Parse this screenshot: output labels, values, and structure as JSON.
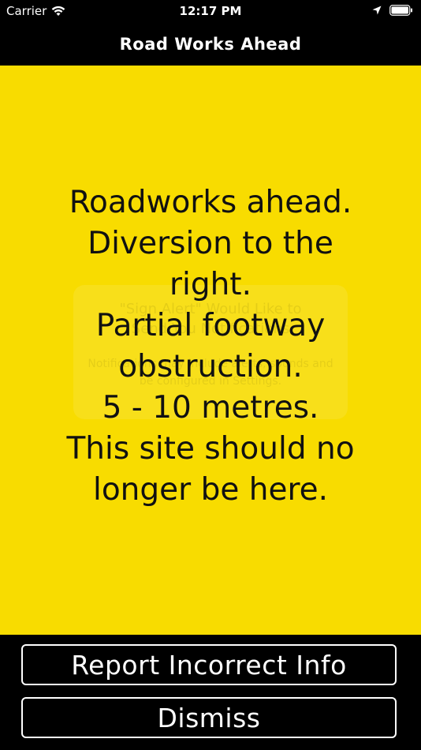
{
  "status_bar": {
    "carrier": "Carrier",
    "time": "12:17 PM",
    "icons": [
      "wifi-icon",
      "location-arrow-icon",
      "battery-icon"
    ]
  },
  "nav": {
    "title": "Road Works Ahead"
  },
  "sign": {
    "lines": [
      "Roadworks ahead.",
      "Diversion to the",
      "right.",
      "Partial footway",
      "obstruction.",
      "5 - 10 metres.",
      "This site should no",
      "longer be here."
    ],
    "background_color": "#f8dc00",
    "text_color": "#111111"
  },
  "ghost_alert": {
    "title_line1": "\"Sign Alert\" Would Like to",
    "title_line2": "Send You Notifications",
    "body_line1": "Notifications may include alerts, sounds and",
    "body_line2": "be configured in Settings."
  },
  "actions": {
    "report_label": "Report Incorrect Info",
    "dismiss_label": "Dismiss"
  }
}
